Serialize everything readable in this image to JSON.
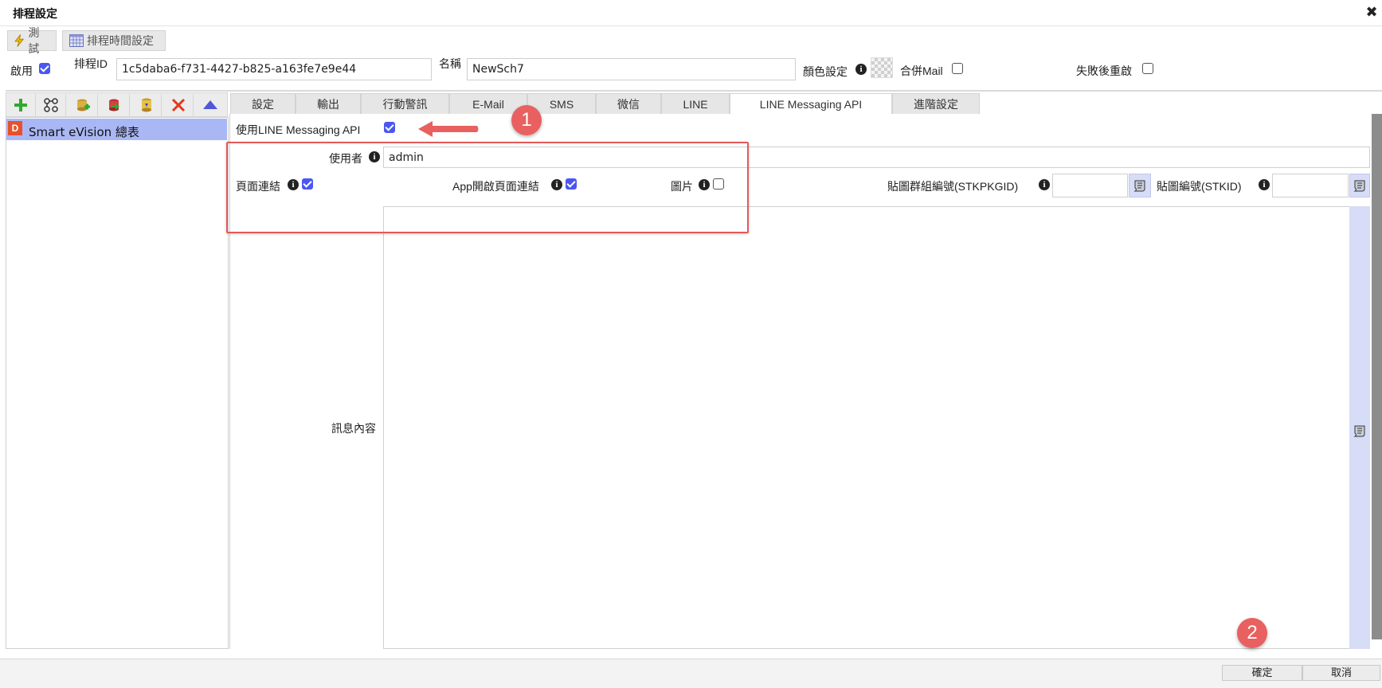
{
  "window": {
    "title": "排程設定"
  },
  "toolbar": {
    "test_label": "測試",
    "schedule_time_label": "排程時間設定"
  },
  "form": {
    "enable_label": "啟用",
    "enable_checked": true,
    "schedule_id_label": "排程ID",
    "schedule_id_value": "1c5daba6-f731-4427-b825-a163fe7e9e44",
    "name_label": "名稱",
    "name_value": "NewSch7",
    "color_label": "顏色設定",
    "merge_mail_label": "合併Mail",
    "merge_mail_checked": false,
    "retry_label": "失敗後重啟",
    "retry_checked": false
  },
  "left_panel": {
    "toolbar_icons": [
      "add-icon",
      "flow-icon",
      "add-db-icon",
      "export-db-icon",
      "db-icon",
      "delete-icon",
      "up-arrow-icon"
    ],
    "tree_items": [
      {
        "badge": "D",
        "label": "Smart eVision 總表"
      }
    ]
  },
  "tabs": [
    "設定",
    "輸出",
    "行動警訊",
    "E-Mail",
    "SMS",
    "微信",
    "LINE",
    "LINE Messaging API",
    "進階設定"
  ],
  "active_tab": "LINE Messaging API",
  "line_api": {
    "use_label": "使用LINE Messaging API",
    "use_checked": true,
    "user_label": "使用者",
    "user_value": "admin",
    "page_link_label": "頁面連結",
    "page_link_checked": true,
    "app_link_label": "App開啟頁面連結",
    "app_link_checked": true,
    "image_label": "圖片",
    "image_checked": false,
    "sticker_group_label": "貼圖群組編號(STKPKGID)",
    "sticker_group_value": "",
    "sticker_id_label": "貼圖編號(STKID)",
    "sticker_id_value": "",
    "message_label": "訊息內容",
    "message_value": ""
  },
  "annotations": {
    "badge1": "1",
    "badge2": "2"
  },
  "footer": {
    "ok_label": "確定",
    "cancel_label": "取消"
  },
  "colors": {
    "accent": "#4a57f0",
    "annotation": "#e8605f",
    "selected_row": "#a9b7f5"
  }
}
